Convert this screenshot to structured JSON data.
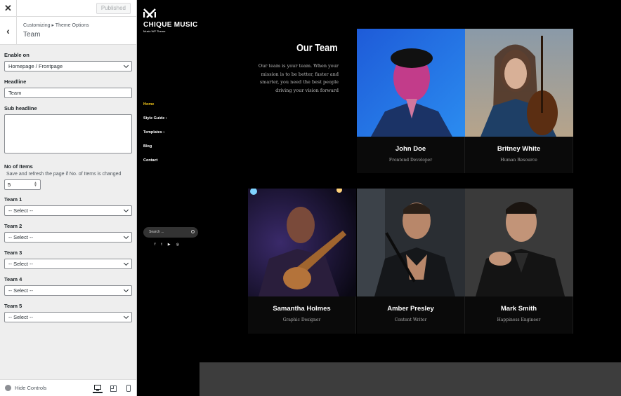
{
  "customizer": {
    "close_icon": "close-icon",
    "published_label": "Published",
    "breadcrumb": "Customizing ▸ Theme Options",
    "section_title": "Team",
    "fields": {
      "enable_on": {
        "label": "Enable on",
        "value": "Homepage / Frontpage"
      },
      "headline": {
        "label": "Headline",
        "value": "Team"
      },
      "sub_headline": {
        "label": "Sub headline",
        "value": ""
      },
      "no_items": {
        "label": "No of Items",
        "description": "Save and refresh the page if No. of Items is changed",
        "value": "5"
      },
      "team": [
        {
          "label": "Team 1",
          "value": "-- Select --"
        },
        {
          "label": "Team 2",
          "value": "-- Select --"
        },
        {
          "label": "Team 3",
          "value": "-- Select --"
        },
        {
          "label": "Team 4",
          "value": "-- Select --"
        },
        {
          "label": "Team 5",
          "value": "-- Select --"
        }
      ]
    },
    "footer": {
      "hide_controls": "Hide Controls"
    }
  },
  "site": {
    "brand": "CHIQUE MUSIC",
    "tagline": "Music WP Theme",
    "nav": [
      "Home",
      "Style Guide",
      "Templates",
      "Blog",
      "Contact"
    ],
    "nav_arrows": [
      "",
      "›",
      "›",
      "",
      ""
    ],
    "search_placeholder": "Search ...",
    "social_icons": [
      "facebook-icon",
      "twitter-icon",
      "youtube-icon",
      "dribbble-icon"
    ],
    "social_glyphs": [
      "f",
      "t",
      "▶",
      "◎"
    ],
    "team_title": "Our Team",
    "team_intro": "Our team is your team. When your mission is to be better, faster and smarter, you need the best people driving your vision forward",
    "members": [
      {
        "name": "John Doe",
        "role": "Frontend Developer"
      },
      {
        "name": "Britney White",
        "role": "Human Resource"
      },
      {
        "name": "Samantha Holmes",
        "role": "Graphic Designer"
      },
      {
        "name": "Amber Presley",
        "role": "Content Writer"
      },
      {
        "name": "Mark Smith",
        "role": "Happiness Engineer"
      }
    ],
    "colors": {
      "accent": "#f0c419",
      "background": "#000000"
    }
  }
}
